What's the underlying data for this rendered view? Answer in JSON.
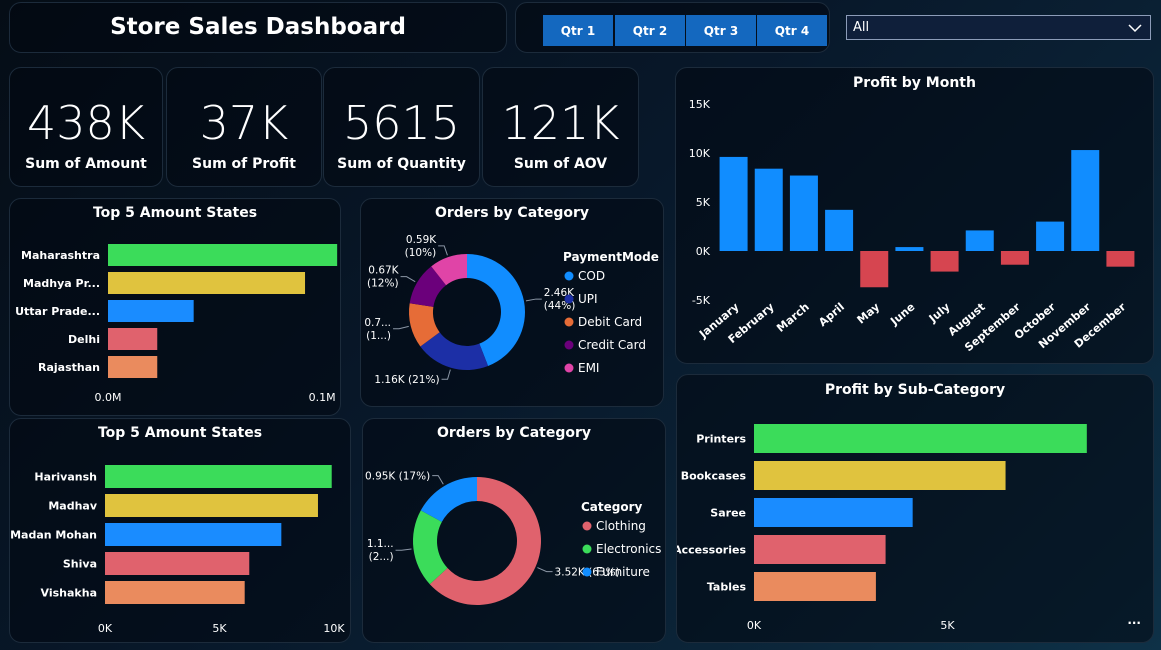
{
  "header": {
    "title": "Store Sales Dashboard"
  },
  "quarters": [
    "Qtr 1",
    "Qtr 2",
    "Qtr 3",
    "Qtr 4"
  ],
  "filter": {
    "selected": "All"
  },
  "kpis": [
    {
      "value": "438K",
      "label": "Sum of Amount"
    },
    {
      "value": "37K",
      "label": "Sum of Profit"
    },
    {
      "value": "5615",
      "label": "Sum of Quantity"
    },
    {
      "value": "121K",
      "label": "Sum of AOV"
    }
  ],
  "chart_data": [
    {
      "id": "states",
      "type": "bar",
      "title": "Top 5 Amount States",
      "categories": [
        "Maharashtra",
        "Madhya Pr...",
        "Uttar Prade...",
        "Delhi",
        "Rajasthan"
      ],
      "values": [
        0.107,
        0.092,
        0.04,
        0.023,
        0.023
      ],
      "xlim": [
        0,
        0.12
      ],
      "xticks": [
        0,
        0.1
      ],
      "xtick_labels": [
        "0.0M",
        "0.1M"
      ],
      "colors": [
        "#3bdc5a",
        "#e0c33e",
        "#1a8cff",
        "#e0626d",
        "#ea8b5e"
      ]
    },
    {
      "id": "payment",
      "type": "pie",
      "title": "Orders by Category",
      "legend_title": "PaymentMode",
      "labels": [
        "COD",
        "UPI",
        "Debit Card",
        "Credit Card",
        "EMI"
      ],
      "values": [
        2.46,
        1.16,
        0.7,
        0.67,
        0.59
      ],
      "data_labels": [
        "2.46K\n(44%)",
        "1.16K (21%)",
        "0.7...\n(1...)",
        "0.67K\n(12%)",
        "0.59K\n(10%)"
      ],
      "colors": [
        "#118dff",
        "#1c2fa6",
        "#e66c37",
        "#6b007b",
        "#e044a7"
      ]
    },
    {
      "id": "month",
      "type": "bar",
      "title": "Profit by Month",
      "categories": [
        "January",
        "February",
        "March",
        "April",
        "May",
        "June",
        "July",
        "August",
        "September",
        "October",
        "November",
        "December"
      ],
      "values": [
        9600,
        8400,
        7700,
        4200,
        -3700,
        400,
        -2100,
        2100,
        -1400,
        3000,
        10300,
        -1600
      ],
      "ylim": [
        -5000,
        15000
      ],
      "yticks": [
        -5000,
        0,
        5000,
        10000,
        15000
      ],
      "ytick_labels": [
        "-5K",
        "0K",
        "5K",
        "10K",
        "15K"
      ],
      "pos_color": "#118dff",
      "neg_color": "#d64550"
    },
    {
      "id": "customers",
      "type": "bar",
      "title": "Top 5 Amount States",
      "categories": [
        "Harivansh",
        "Madhav",
        "Madan Mohan",
        "Shiva",
        "Vishakha"
      ],
      "values": [
        9900,
        9300,
        7700,
        6300,
        6100
      ],
      "xlim": [
        0,
        10000
      ],
      "xticks": [
        0,
        5000,
        10000
      ],
      "xtick_labels": [
        "0K",
        "5K",
        "10K"
      ],
      "colors": [
        "#3bdc5a",
        "#e0c33e",
        "#1a8cff",
        "#e0626d",
        "#ea8b5e"
      ]
    },
    {
      "id": "category",
      "type": "pie",
      "title": "Orders by Category",
      "legend_title": "Category",
      "labels": [
        "Clothing",
        "Electronics",
        "Furniture"
      ],
      "values": [
        3.52,
        1.1,
        0.95
      ],
      "data_labels": [
        "3.52K (63%)",
        "1.1...\n(2...)",
        "0.95K (17%)"
      ],
      "colors": [
        "#e0626d",
        "#3bdc5a",
        "#118dff"
      ]
    },
    {
      "id": "subcat",
      "type": "bar",
      "title": "Profit by Sub-Category",
      "categories": [
        "Printers",
        "Bookcases",
        "Saree",
        "Accessories",
        "Tables"
      ],
      "values": [
        8600,
        6500,
        4100,
        3400,
        3150
      ],
      "xlim": [
        0,
        10000
      ],
      "xticks": [
        0,
        5000
      ],
      "xtick_labels": [
        "0K",
        "5K"
      ],
      "colors": [
        "#3bdc5a",
        "#e0c33e",
        "#1a8cff",
        "#e0626d",
        "#ea8b5e"
      ]
    }
  ],
  "more_options": "..."
}
